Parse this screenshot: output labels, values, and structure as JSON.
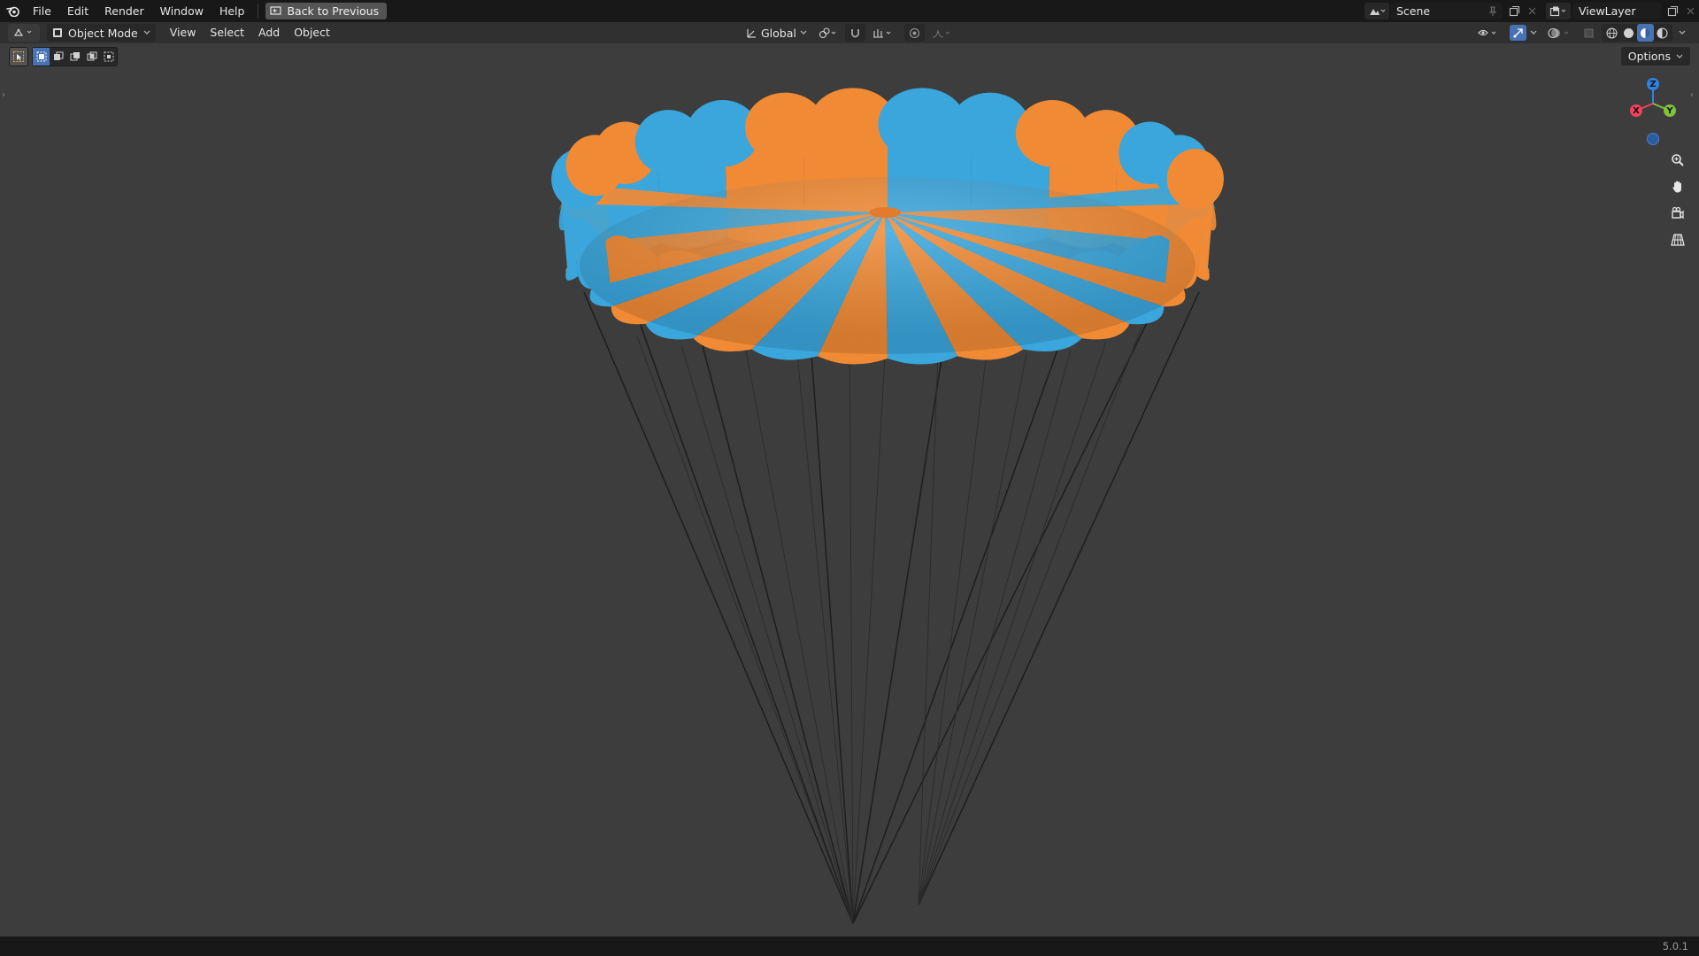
{
  "topbar": {
    "menus": [
      "File",
      "Edit",
      "Render",
      "Window",
      "Help"
    ],
    "back_button": "Back to Previous",
    "scene": "Scene",
    "view_layer": "ViewLayer"
  },
  "viewport_header": {
    "mode": "Object Mode",
    "menus": [
      "View",
      "Select",
      "Add",
      "Object"
    ],
    "transform_orientation": "Global"
  },
  "tool_settings": {
    "options_label": "Options"
  },
  "gizmo": {
    "x_label": "X",
    "y_label": "Y",
    "z_label": "Z",
    "colors": {
      "x": "#f0425b",
      "y": "#80c33b",
      "z": "#2f83e3",
      "neg_z": "#2a5ca0"
    }
  },
  "canopy": {
    "colors": {
      "orange": "#f08a35",
      "blue": "#3aa6dc"
    }
  },
  "statusbar": {
    "version": "5.0.1"
  },
  "theme": {
    "accent": "#4772b3",
    "viewport_bg": "#3d3d3d",
    "header_bg": "#303030",
    "topbar_bg": "#181818"
  }
}
